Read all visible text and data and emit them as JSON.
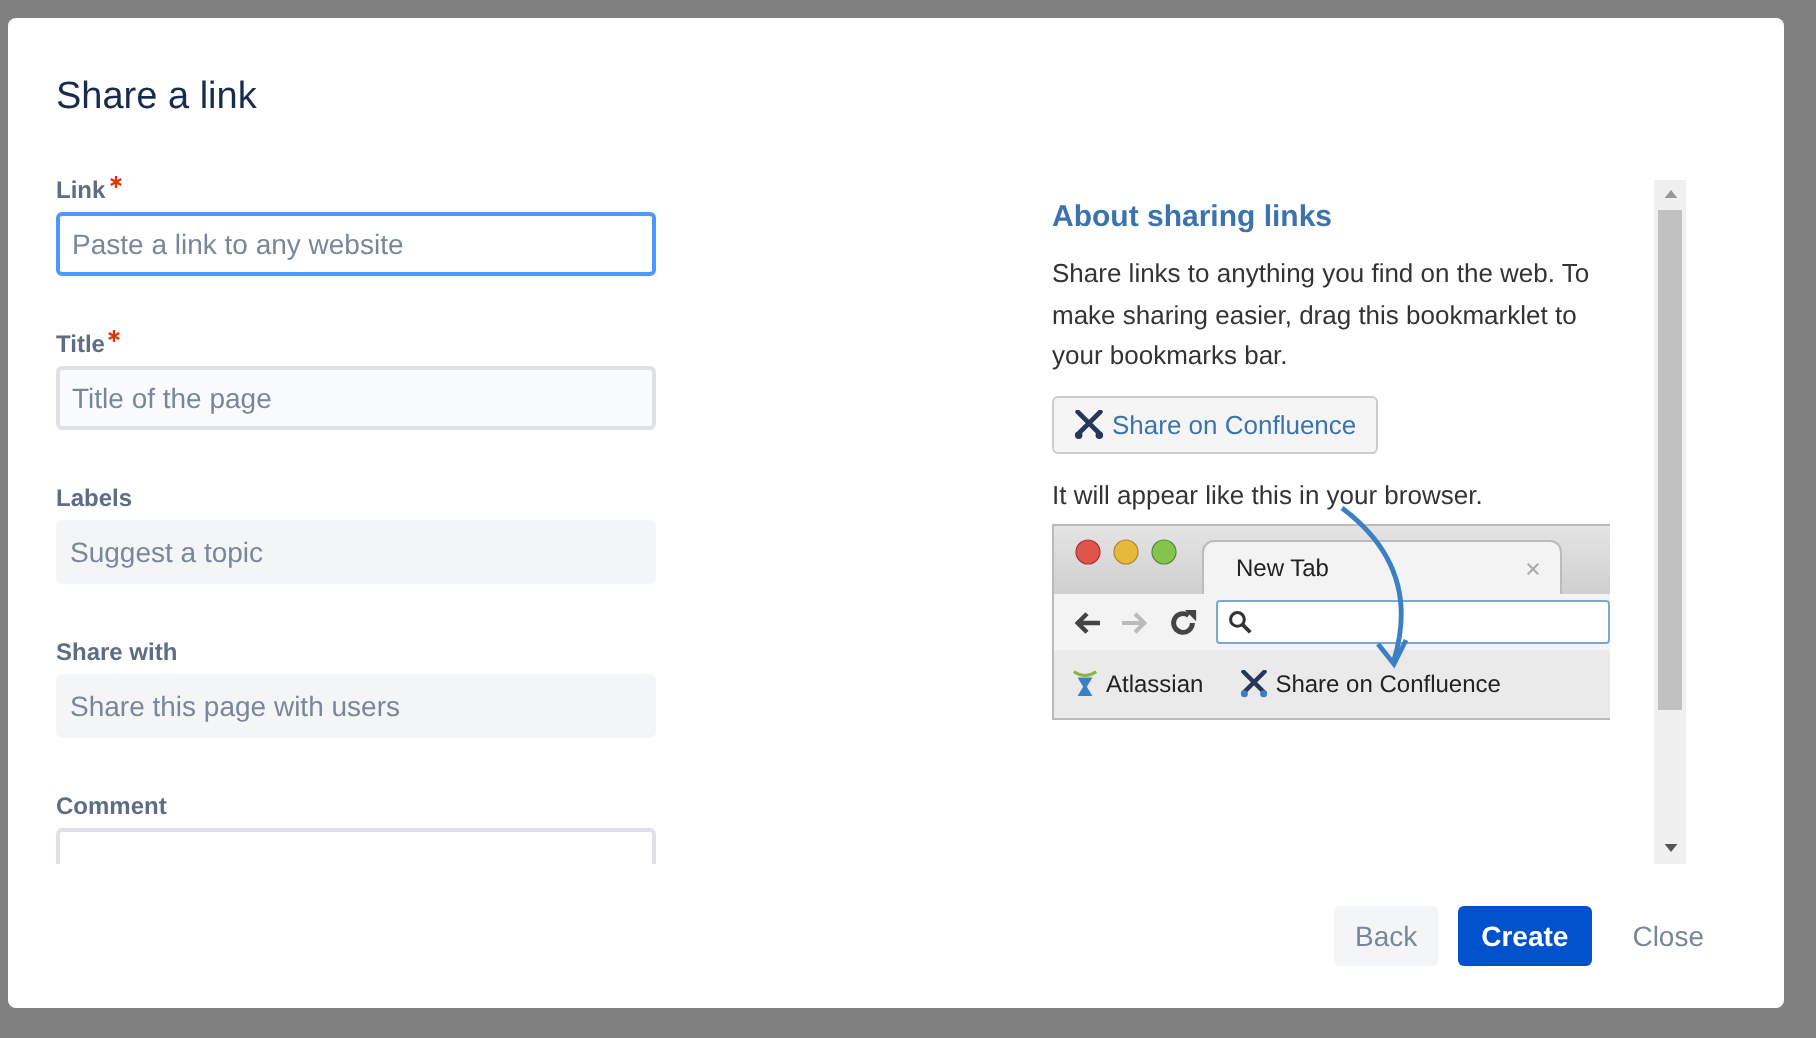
{
  "dialog": {
    "title": "Share a link"
  },
  "fields": [
    {
      "label": "Link",
      "required": true,
      "kind": "text",
      "focused": true,
      "placeholder": "Paste a link to any website"
    },
    {
      "label": "Title",
      "required": true,
      "kind": "text",
      "focused": false,
      "placeholder": "Title of the page"
    },
    {
      "label": "Labels",
      "required": false,
      "kind": "picker",
      "placeholder": "Suggest a topic"
    },
    {
      "label": "Share with",
      "required": false,
      "kind": "picker",
      "placeholder": "Share this page with users"
    },
    {
      "label": "Comment",
      "required": false,
      "kind": "textarea"
    }
  ],
  "about": {
    "heading": "About sharing links",
    "text": "Share links to anything you find on the web. To make sharing easier, drag this bookmarklet to your bookmarks bar.",
    "bookmarklet": "Share on Confluence",
    "note": "It will appear like this in your browser.",
    "illustration": {
      "tab_title": "New Tab",
      "bookmarks": [
        {
          "label": "Atlassian",
          "kind": "atlassian"
        },
        {
          "label": "Share on Confluence",
          "kind": "confluence"
        }
      ]
    }
  },
  "buttons": [
    {
      "label": "Back",
      "kind": "subtle"
    },
    {
      "label": "Create",
      "kind": "primary"
    },
    {
      "label": "Close",
      "kind": "link"
    }
  ]
}
